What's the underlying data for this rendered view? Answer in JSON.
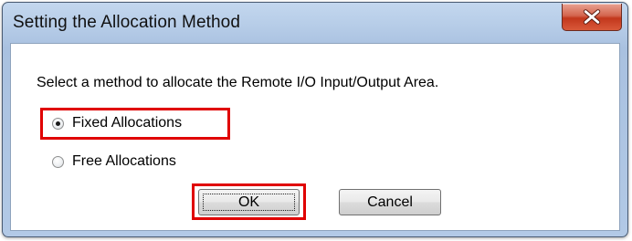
{
  "dialog": {
    "title": "Setting the Allocation Method",
    "prompt": "Select a method to allocate the Remote I/O Input/Output Area.",
    "options": [
      {
        "label": "Fixed Allocations",
        "selected": true
      },
      {
        "label": "Free Allocations",
        "selected": false
      }
    ],
    "buttons": {
      "ok": "OK",
      "cancel": "Cancel"
    },
    "icons": {
      "close": "close-icon",
      "radio": "radio-button-icon"
    },
    "colors": {
      "highlight": "#e00000",
      "close_button": "#c2371c",
      "frame": "#b7cde8"
    }
  }
}
